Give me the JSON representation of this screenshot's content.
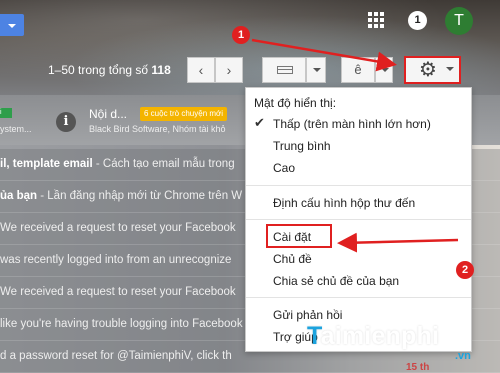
{
  "header": {
    "notification_count": "1",
    "avatar_letter": "T",
    "pager_prefix": "1–50 trong tổng số ",
    "pager_total": "118",
    "prev_glyph": "‹",
    "next_glyph": "›",
    "input_tool_glyph": "ê"
  },
  "tabs": {
    "tab1_label": "i",
    "tab1_sub": "ystem...",
    "tab2_title": "Nội d...",
    "tab2_badge": "6 cuộc trò chuyện mới",
    "tab2_sub": "Black Bird Software, Nhóm tài khỏ"
  },
  "messages": [
    {
      "bold": "il, template email",
      "snippet": " - Cách tạo email mẫu trong"
    },
    {
      "bold": "ủa bạn",
      "snippet": " - Lần đăng nhập mới từ Chrome trên W"
    },
    {
      "bold": "",
      "snippet": "We received a request to reset your Facebook"
    },
    {
      "bold": "",
      "snippet": "was recently logged into from an unrecognize"
    },
    {
      "bold": "",
      "snippet": "We received a request to reset your Facebook"
    },
    {
      "bold": "",
      "snippet": "like you're having trouble logging into Facebook"
    },
    {
      "bold": "",
      "snippet": "d a password reset for @TaimienphiV, click th"
    }
  ],
  "menu": {
    "density_header": "Mật độ hiển thị:",
    "density_low": "Thấp (trên màn hình lớn hơn)",
    "density_medium": "Trung bình",
    "density_high": "Cao",
    "configure_inbox": "Định cấu hình hộp thư đến",
    "settings": "Cài đặt",
    "themes": "Chủ đề",
    "share_themes": "Chia sẻ chủ đề của bạn",
    "send_feedback": "Gửi phản hồi",
    "help": "Trợ giúp"
  },
  "annotations": {
    "marker1": "1",
    "marker2": "2",
    "accent_color": "#e02020"
  },
  "watermark": {
    "text_t": "T",
    "text_rest": "aimienphi",
    "suffix": ".vn",
    "date_fragment": "15 th"
  },
  "icons": [
    "apps-grid-icon",
    "gear-icon",
    "chevron-left-icon",
    "chevron-right-icon",
    "density-icon",
    "info-icon",
    "check-icon",
    "arrow-icon"
  ]
}
